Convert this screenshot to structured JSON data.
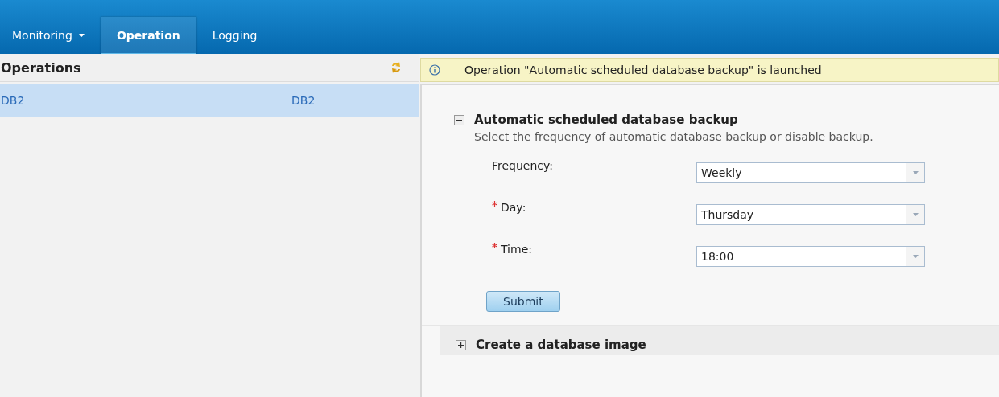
{
  "nav": {
    "tabs": [
      {
        "label": "Monitoring",
        "selected": false,
        "has_menu": true
      },
      {
        "label": "Operation",
        "selected": true,
        "has_menu": false
      },
      {
        "label": "Logging",
        "selected": false,
        "has_menu": false
      }
    ]
  },
  "operations": {
    "title": "Operations",
    "rows": [
      {
        "cells": [
          "DB2",
          "DB2"
        ],
        "selected": true
      }
    ]
  },
  "notice": {
    "text": "Operation \"Automatic scheduled database backup\" is launched"
  },
  "sections": [
    {
      "title": "Automatic scheduled database backup",
      "expanded": true,
      "description": "Select the frequency of automatic database backup or disable backup.",
      "fields": [
        {
          "label": "Frequency:",
          "required": false,
          "value": "Weekly"
        },
        {
          "label": "Day:",
          "required": true,
          "value": "Thursday"
        },
        {
          "label": "Time:",
          "required": true,
          "value": "18:00"
        }
      ],
      "button": "Submit"
    },
    {
      "title": "Create a database image",
      "expanded": false
    }
  ]
}
